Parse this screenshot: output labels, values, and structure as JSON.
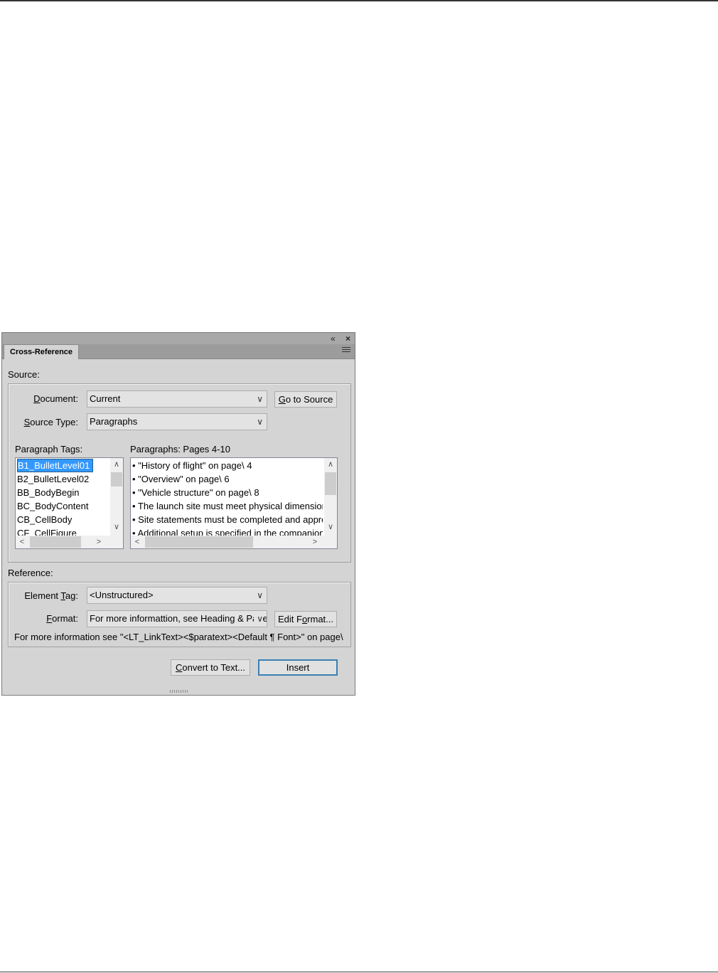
{
  "panel": {
    "tab_label": "Cross-Reference",
    "collapse_glyph": "«",
    "close_glyph": "×",
    "menu_icon": "hamburger-menu-icon"
  },
  "source": {
    "section_label": "Source:",
    "document_label_u": "D",
    "document_label_rest": "ocument:",
    "document_value": "Current",
    "goto_source_u": "G",
    "goto_source_rest": "o to Source",
    "source_type_label_u": "S",
    "source_type_label_rest": "ource Type:",
    "source_type_value": "Paragraphs",
    "paragraph_tags_label": "Paragraph Tags:",
    "paragraph_tags": [
      "B1_BulletLevel01",
      "B2_BulletLevel02",
      "BB_BodyBegin",
      "BC_BodyContent",
      "CB_CellBody",
      "CF_CellFigure"
    ],
    "selected_tag_index": 0,
    "paragraphs_label": "Paragraphs: Pages  4-10",
    "paragraphs": [
      "• \"History of flight\" on page\\ 4",
      "• \"Overview\" on page\\ 6",
      "• \"Vehicle structure\" on page\\ 8",
      "• The launch site must meet physical dimensions",
      "• Site statements must be completed and approved",
      "• Additional setup is specified in the companion"
    ]
  },
  "reference": {
    "section_label": "Reference:",
    "element_tag_label_pre": "Element ",
    "element_tag_label_u": "T",
    "element_tag_label_rest": "ag:",
    "element_tag_value": "<Unstructured>",
    "format_label_u": "F",
    "format_label_rest": "ormat:",
    "format_value": "For more informattion, see Heading & Page",
    "edit_format_pre": "Edit F",
    "edit_format_u": "o",
    "edit_format_rest": "rmat...",
    "preview_text": "For more information see \"<LT_LinkText><$paratext><Default ¶ Font>\" on page\\ <$pagenum>"
  },
  "actions": {
    "convert_u": "C",
    "convert_rest": "onvert to Text...",
    "insert_label": "Insert"
  }
}
